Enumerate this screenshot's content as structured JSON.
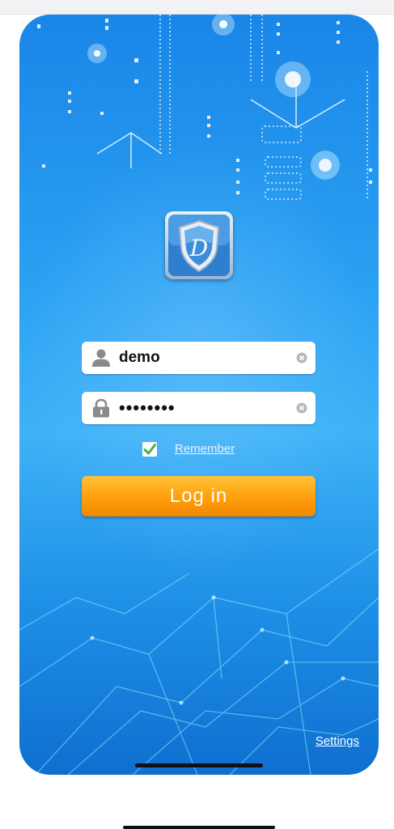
{
  "login_form": {
    "username_value": "demo",
    "password_value": "••••••••",
    "remember_checked": true,
    "remember_label": "Remember",
    "login_button_label": "Log in"
  },
  "footer": {
    "settings_label": "Settings"
  },
  "icons": {
    "username": "user-icon",
    "password": "lock-icon",
    "clear": "clear-circle-icon",
    "check": "checkmark-icon",
    "logo": "shield-logo-icon"
  },
  "colors": {
    "background_blue": "#2aa0f2",
    "login_button": "#ffa10c",
    "checkmark": "#3cb54a"
  }
}
